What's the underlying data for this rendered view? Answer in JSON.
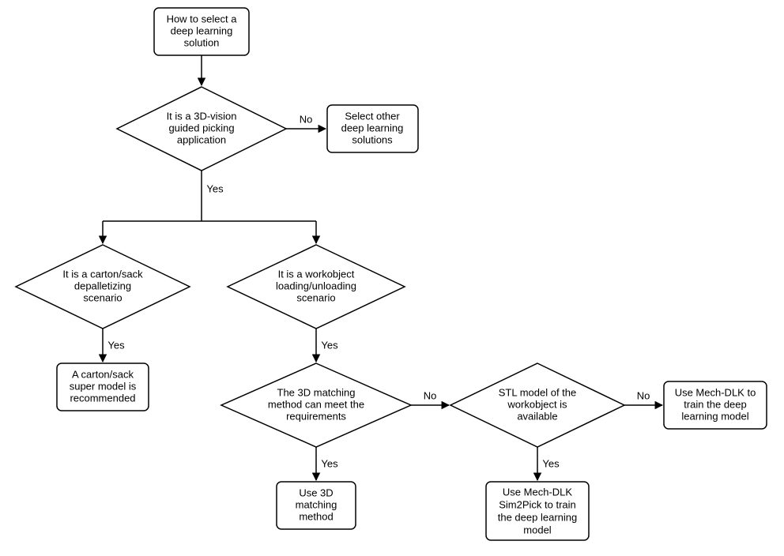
{
  "chart_data": {
    "type": "flowchart",
    "nodes": [
      {
        "id": "start",
        "kind": "process",
        "lines": [
          "How to select a",
          "deep learning",
          "solution"
        ]
      },
      {
        "id": "d1",
        "kind": "decision",
        "lines": [
          "It is a 3D-vision",
          "guided picking",
          "application"
        ]
      },
      {
        "id": "other",
        "kind": "process",
        "lines": [
          "Select other",
          "deep learning",
          "solutions"
        ]
      },
      {
        "id": "d2",
        "kind": "decision",
        "lines": [
          "It is a carton/sack",
          "depalletizing",
          "scenario"
        ]
      },
      {
        "id": "d3",
        "kind": "decision",
        "lines": [
          "It is a workobject",
          "loading/unloading",
          "scenario"
        ]
      },
      {
        "id": "carton",
        "kind": "process",
        "lines": [
          "A carton/sack",
          "super model is",
          "recommended"
        ]
      },
      {
        "id": "d4",
        "kind": "decision",
        "lines": [
          "The 3D matching",
          "method can meet the",
          "requirements"
        ]
      },
      {
        "id": "match3d",
        "kind": "process",
        "lines": [
          "Use 3D",
          "matching",
          "method"
        ]
      },
      {
        "id": "d5",
        "kind": "decision",
        "lines": [
          "STL model of the",
          "workobject is",
          "available"
        ]
      },
      {
        "id": "sim2pick",
        "kind": "process",
        "lines": [
          "Use Mech-DLK",
          "Sim2Pick to train",
          "the deep learning",
          "model"
        ]
      },
      {
        "id": "mechdlk",
        "kind": "process",
        "lines": [
          "Use Mech-DLK to",
          "train the deep",
          "learning model"
        ]
      }
    ],
    "edges": [
      {
        "from": "start",
        "to": "d1",
        "label": ""
      },
      {
        "from": "d1",
        "to": "other",
        "label": "No"
      },
      {
        "from": "d1",
        "to": "d2",
        "label": "Yes"
      },
      {
        "from": "d1",
        "to": "d3",
        "label": "Yes"
      },
      {
        "from": "d2",
        "to": "carton",
        "label": "Yes"
      },
      {
        "from": "d3",
        "to": "d4",
        "label": "Yes"
      },
      {
        "from": "d4",
        "to": "match3d",
        "label": "Yes"
      },
      {
        "from": "d4",
        "to": "d5",
        "label": "No"
      },
      {
        "from": "d5",
        "to": "sim2pick",
        "label": "Yes"
      },
      {
        "from": "d5",
        "to": "mechdlk",
        "label": "No"
      }
    ]
  },
  "labels": {
    "yes": "Yes",
    "no": "No"
  }
}
